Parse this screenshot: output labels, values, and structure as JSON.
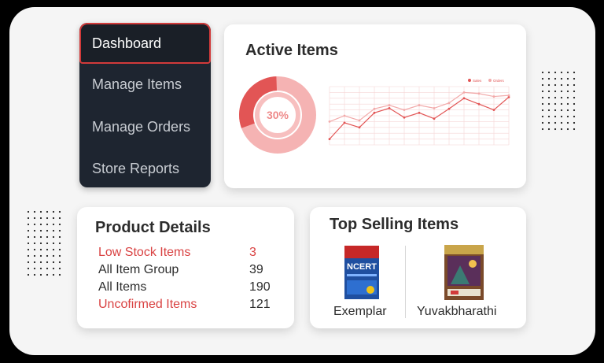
{
  "nav": {
    "items": [
      {
        "label": "Dashboard"
      },
      {
        "label": "Manage Items"
      },
      {
        "label": "Manage Orders"
      },
      {
        "label": "Store Reports"
      }
    ]
  },
  "active_items": {
    "title": "Active Items",
    "donut_percent_label": "30%",
    "donut_fraction": 0.3,
    "legend": [
      "Sales",
      "Orders"
    ]
  },
  "chart_data": {
    "type": "line",
    "x": [
      1,
      2,
      3,
      4,
      5,
      6,
      7,
      8,
      9,
      10,
      11,
      12,
      13
    ],
    "series": [
      {
        "name": "Sales",
        "values": [
          10,
          38,
          30,
          55,
          63,
          47,
          55,
          45,
          62,
          80,
          70,
          60,
          82
        ]
      },
      {
        "name": "Orders",
        "values": [
          40,
          50,
          42,
          62,
          68,
          60,
          68,
          63,
          72,
          90,
          88,
          83,
          85
        ]
      }
    ],
    "ylim": [
      0,
      100
    ],
    "grid": true,
    "legend_position": "top-right",
    "colors": [
      "#e25555",
      "#f2aaaa"
    ]
  },
  "product_details": {
    "title": "Product Details",
    "rows": [
      {
        "label": "Low Stock Items",
        "value": "3",
        "highlight": true
      },
      {
        "label": "All Item Group",
        "value": "39",
        "highlight": false
      },
      {
        "label": "All Items",
        "value": "190",
        "highlight": false
      },
      {
        "label": "Uncofirmed Items",
        "value": "121",
        "highlight": true
      }
    ]
  },
  "top_selling": {
    "title": "Top Selling Items",
    "items": [
      {
        "label": "Exemplar",
        "cover_text": "NCERT"
      },
      {
        "label": "Yuvakbharathi",
        "cover_text": ""
      }
    ]
  },
  "colors": {
    "accent": "#d94242",
    "nav_bg": "#1e2530",
    "page_bg": "#f5f5f5"
  }
}
